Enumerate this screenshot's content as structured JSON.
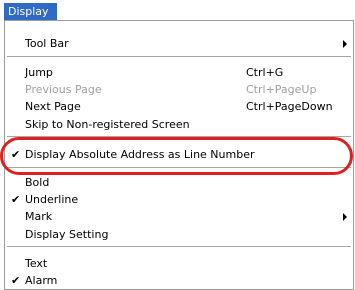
{
  "menubar": {
    "title": "Display"
  },
  "menu": {
    "toolbar": {
      "label": "Tool Bar"
    },
    "jump": {
      "label": "Jump",
      "shortcut": "Ctrl+G"
    },
    "previous_page": {
      "label": "Previous Page",
      "shortcut": "Ctrl+PageUp"
    },
    "next_page": {
      "label": "Next Page",
      "shortcut": "Ctrl+PageDown"
    },
    "skip": {
      "label": "Skip to Non-registered Screen"
    },
    "display_absolute": {
      "label": "Display Absolute Address as Line Number",
      "checked": true
    },
    "bold": {
      "label": "Bold"
    },
    "underline": {
      "label": "Underline",
      "checked": true
    },
    "mark": {
      "label": "Mark"
    },
    "display_setting": {
      "label": "Display Setting"
    },
    "text": {
      "label": "Text"
    },
    "alarm": {
      "label": "Alarm",
      "checked": true
    },
    "check_glyph": "✔"
  },
  "colors": {
    "menu_highlight": "#316ac5",
    "disabled_text": "#a0a0a0",
    "annotation_ring": "#e02020"
  },
  "icons": {
    "submenu": "chevron-right-icon",
    "check": "checkmark-icon"
  }
}
